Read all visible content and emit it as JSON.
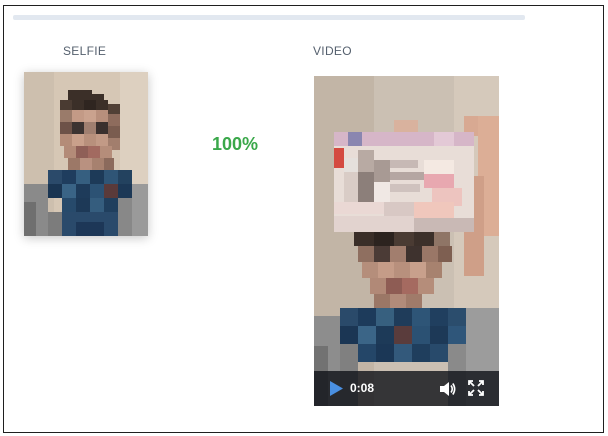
{
  "selfie": {
    "label": "SELFIE"
  },
  "video": {
    "label": "VIDEO",
    "time": "0:08"
  },
  "match": {
    "score": "100%",
    "color": "#3aa84a"
  },
  "icons": {
    "play": "play-icon",
    "volume": "volume-icon",
    "fullscreen": "fullscreen-icon"
  },
  "colors": {
    "accent_blue": "#4a90e2",
    "divider": "#e2e8f0",
    "controls_bg": "#0f1218"
  }
}
